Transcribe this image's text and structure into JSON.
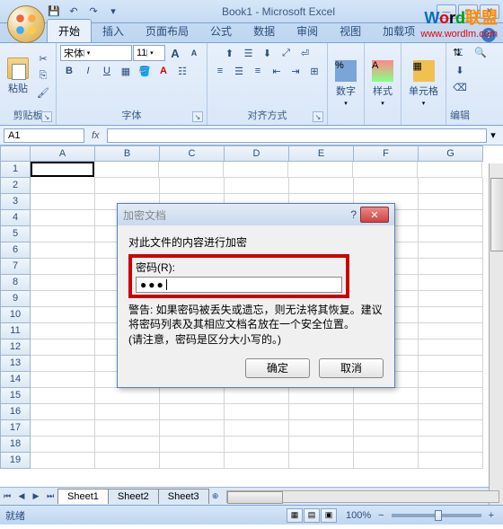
{
  "title": "Book1 - Microsoft Excel",
  "qat": {
    "save": "💾",
    "undo": "↶",
    "redo": "↷"
  },
  "logo": {
    "text": "Word联盟",
    "url": "www.wordlm.com"
  },
  "tabs": [
    "开始",
    "插入",
    "页面布局",
    "公式",
    "数据",
    "审阅",
    "视图",
    "加载项"
  ],
  "active_tab": 0,
  "ribbon": {
    "clipboard": {
      "paste": "粘贴",
      "label": "剪贴板"
    },
    "font": {
      "name": "宋体",
      "size": "11",
      "grow": "A",
      "shrink": "A",
      "bold": "B",
      "italic": "I",
      "underline": "U",
      "label": "字体"
    },
    "align": {
      "label": "对齐方式"
    },
    "number": {
      "big": "数字"
    },
    "style": {
      "big": "样式"
    },
    "cells": {
      "big": "单元格"
    },
    "edit": {
      "label": "编辑"
    }
  },
  "name_box": "A1",
  "fx": "fx",
  "columns": [
    "A",
    "B",
    "C",
    "D",
    "E",
    "F",
    "G"
  ],
  "rows": [
    "1",
    "2",
    "3",
    "4",
    "5",
    "6",
    "7",
    "8",
    "9",
    "10",
    "11",
    "12",
    "13",
    "14",
    "15",
    "16",
    "17",
    "18",
    "19"
  ],
  "dialog": {
    "title": "加密文档",
    "line1": "对此文件的内容进行加密",
    "pwd_label": "密码(R):",
    "pwd_value": "●●●",
    "warn1": "警告: 如果密码被丢失或遗忘，则无法将其恢复。建议将密码列表及其相应文档名放在一个安全位置。",
    "warn2": "(请注意，密码是区分大小写的。)",
    "ok": "确定",
    "cancel": "取消"
  },
  "sheets": [
    "Sheet1",
    "Sheet2",
    "Sheet3"
  ],
  "status": "就绪",
  "zoom": "100%",
  "zoom_minus": "−",
  "zoom_plus": "+"
}
